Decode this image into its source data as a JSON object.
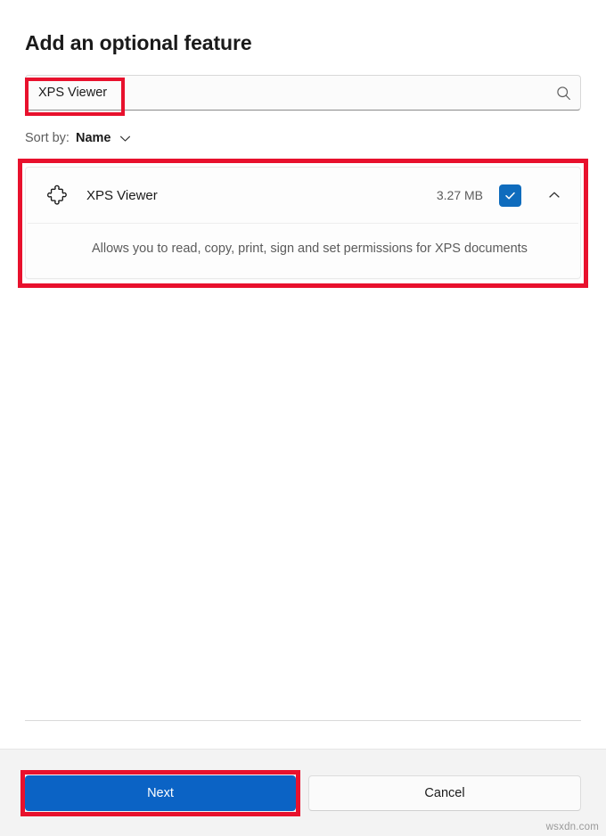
{
  "dialog": {
    "title": "Add an optional feature"
  },
  "search": {
    "value": "XPS Viewer",
    "placeholder": "",
    "icon": "search-icon"
  },
  "sort": {
    "label": "Sort by:",
    "value": "Name",
    "icon": "chevron-down-icon"
  },
  "features": [
    {
      "icon": "puzzle-piece-icon",
      "name": "XPS Viewer",
      "size": "3.27 MB",
      "checked": true,
      "expanded": true,
      "expand_icon": "chevron-up-icon",
      "description": "Allows you to read, copy, print, sign and set permissions for XPS documents"
    }
  ],
  "footer": {
    "next_label": "Next",
    "cancel_label": "Cancel"
  },
  "watermark": {
    "text": "wsxdn.com"
  },
  "colors": {
    "accent": "#0b63c5",
    "checkbox": "#0f6cbd",
    "annotation": "#e8112d",
    "footer_background": "#f3f3f3",
    "body_background": "#ffffff",
    "muted_text": "#5b5b5b"
  }
}
